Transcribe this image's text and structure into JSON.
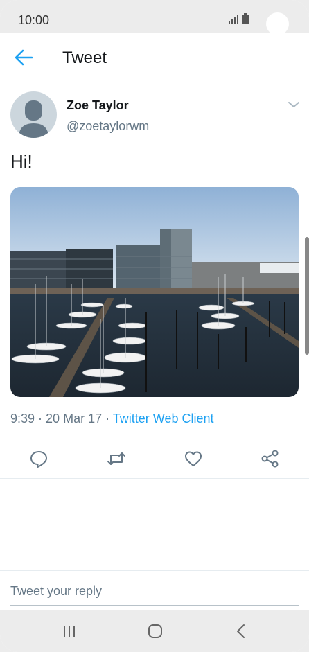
{
  "status": {
    "time": "10:00"
  },
  "header": {
    "title": "Tweet"
  },
  "tweet": {
    "author_name": "Zoe Taylor",
    "author_handle": "@zoetaylorwm",
    "text": "Hi!",
    "time": "9:39",
    "date": "20 Mar 17",
    "client": "Twitter Web Client",
    "separator": " · "
  },
  "reply": {
    "placeholder": "Tweet your reply"
  },
  "colors": {
    "accent": "#1da1f2",
    "text": "#14171a",
    "muted": "#657786"
  },
  "icons": [
    "back-arrow-icon",
    "chevron-down-icon",
    "reply-icon",
    "retweet-icon",
    "like-icon",
    "share-icon",
    "recents-icon",
    "home-icon",
    "nav-back-icon"
  ]
}
